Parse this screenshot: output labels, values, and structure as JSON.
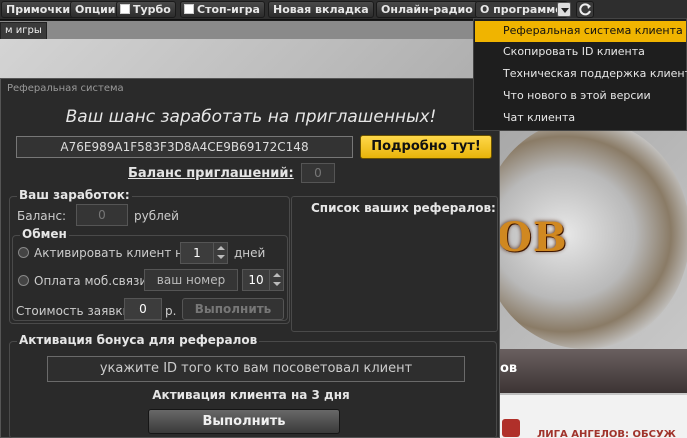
{
  "toolbar": {
    "tricks": "Примочки",
    "options": "Опции",
    "turbo": "Турбо",
    "stop_game": "Стоп-игра",
    "new_tab": "Новая вкладка",
    "radio": "Онлайн-радио",
    "about": "О программе"
  },
  "tab": {
    "label": "м игры"
  },
  "background": {
    "logo_fragment": "ОВ",
    "bar_text": "ов",
    "news_text": "ЛИГА АНГЕЛОВ: ОБСУЖ"
  },
  "dialog": {
    "title": "Реферальная система",
    "headline": "Ваш шанс заработать на приглашенных!",
    "code": "A76E989A1F583F3D8A4CE9B69172C148",
    "more_button": "Подробно тут!",
    "invites_balance_label": "Баланс приглашений:",
    "invites_balance_value": "0",
    "earnings": {
      "title": "Ваш заработок:",
      "balance_label": "Баланс:",
      "balance_value": "0",
      "currency": "рублей"
    },
    "exchange": {
      "title": "Обмен",
      "activate_label": "Активировать клиент на",
      "activate_value": "1",
      "days_label": "дней",
      "mobile_label": "Оплата моб.связи",
      "number_placeholder": "ваш номер",
      "mobile_value": "10",
      "cost_label": "Стоимость заявки:",
      "cost_value": "0",
      "cost_unit": "р.",
      "execute": "Выполнить"
    },
    "referrals": {
      "title": "Список ваших рефералов:"
    },
    "bonus": {
      "title": "Активация бонуса для рефералов",
      "hint": "укажите ID того кто вам посоветовал клиент",
      "activation_label": "Активация клиента на 3 дня",
      "execute": "Выполнить"
    }
  },
  "menu": {
    "items": [
      "Реферальная система клиента",
      "Скопировать ID клиента",
      "Техническая поддержка клиента",
      "Что нового в этой версии",
      "Чат клиента"
    ]
  },
  "colors": {
    "accent": "#f0b400",
    "panel": "#2a2a2a"
  }
}
